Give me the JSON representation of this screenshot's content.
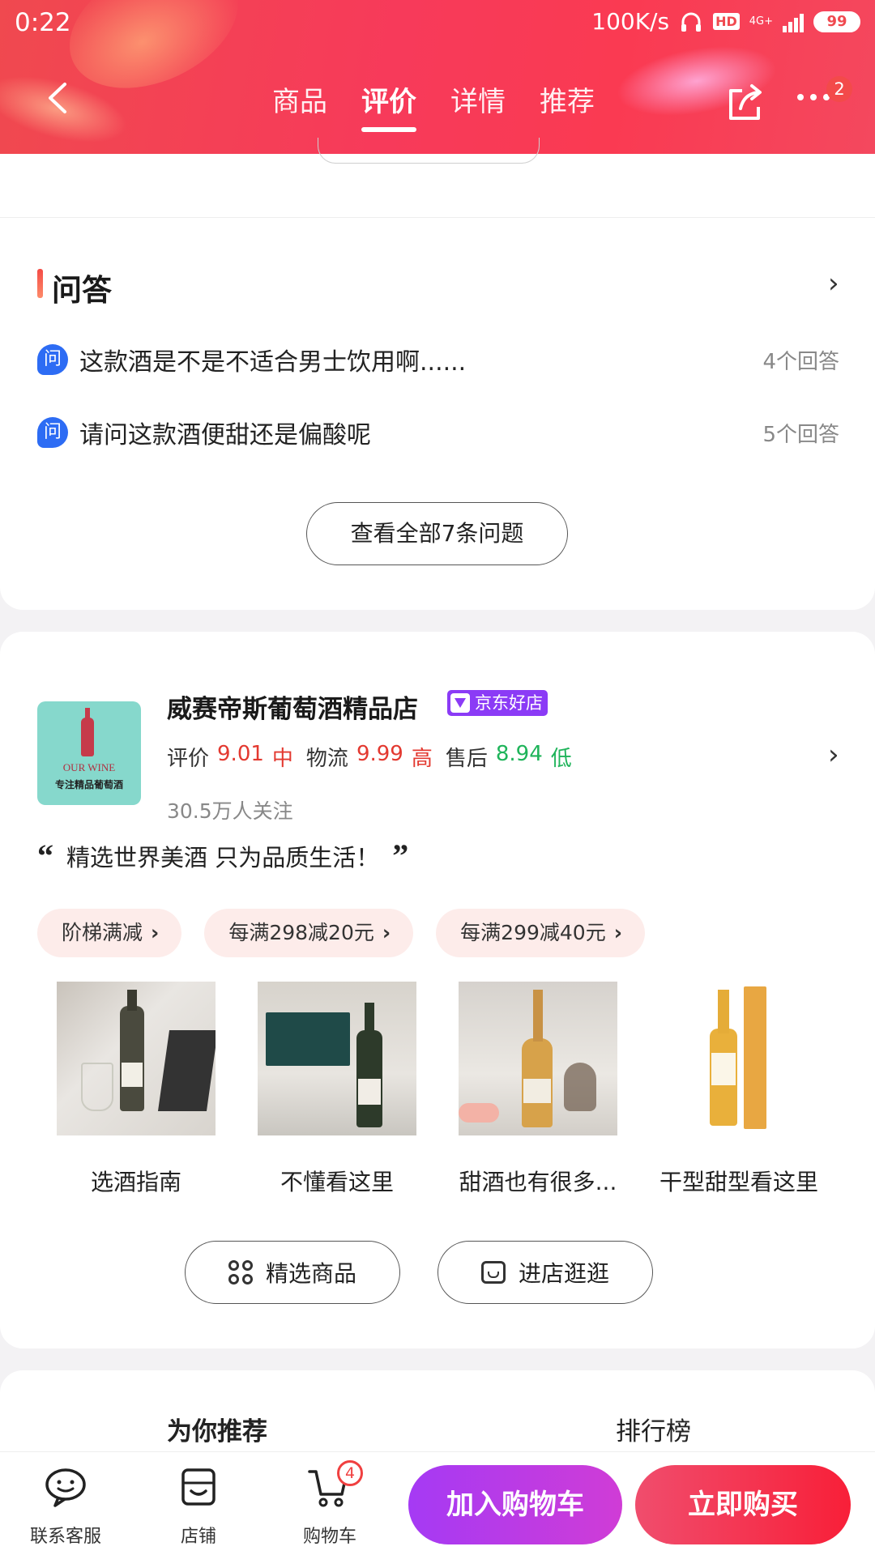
{
  "status_bar": {
    "time": "0:22",
    "speed": "100K/s",
    "hd": "HD",
    "network": "4G+",
    "battery": "99"
  },
  "header": {
    "tabs": [
      {
        "label": "商品",
        "active": false
      },
      {
        "label": "评价",
        "active": true
      },
      {
        "label": "详情",
        "active": false
      },
      {
        "label": "推荐",
        "active": false
      }
    ],
    "more_badge": "2",
    "colors": {
      "header_start": "#f0494f",
      "header_end": "#f4485e"
    }
  },
  "qa": {
    "title": "问答",
    "icon_char": "问",
    "questions": [
      {
        "text": "这款酒是不是不适合男士饮用啊......",
        "answers": "4个回答"
      },
      {
        "text": "请问这款酒便甜还是偏酸呢",
        "answers": "5个回答"
      }
    ],
    "view_all": "查看全部7条问题"
  },
  "shop": {
    "logo_en": "OUR WINE",
    "logo_cn": "专注精品葡萄酒",
    "name": "威赛帝斯葡萄酒精品店",
    "badge": "京东好店",
    "ratings": [
      {
        "label": "评价",
        "score": "9.01",
        "level": "中",
        "color": "red"
      },
      {
        "label": "物流",
        "score": "9.99",
        "level": "高",
        "color": "red"
      },
      {
        "label": "售后",
        "score": "8.94",
        "level": "低",
        "color": "green"
      }
    ],
    "followers": "30.5万人关注",
    "slogan": "精选世界美酒 只为品质生活！",
    "promos": [
      "阶梯满减",
      "每满298减20元",
      "每满299减40元"
    ],
    "guides": [
      "选酒指南",
      "不懂看这里",
      "甜酒也有很多...",
      "干型甜型看这里"
    ],
    "buttons": {
      "featured": "精选商品",
      "visit": "进店逛逛"
    }
  },
  "recommend": {
    "tabs": [
      "为你推荐",
      "排行榜"
    ]
  },
  "bottom_bar": {
    "service": "联系客服",
    "store": "店铺",
    "cart": "购物车",
    "cart_count": "4",
    "add_to_cart": "加入购物车",
    "buy_now": "立即购买"
  }
}
